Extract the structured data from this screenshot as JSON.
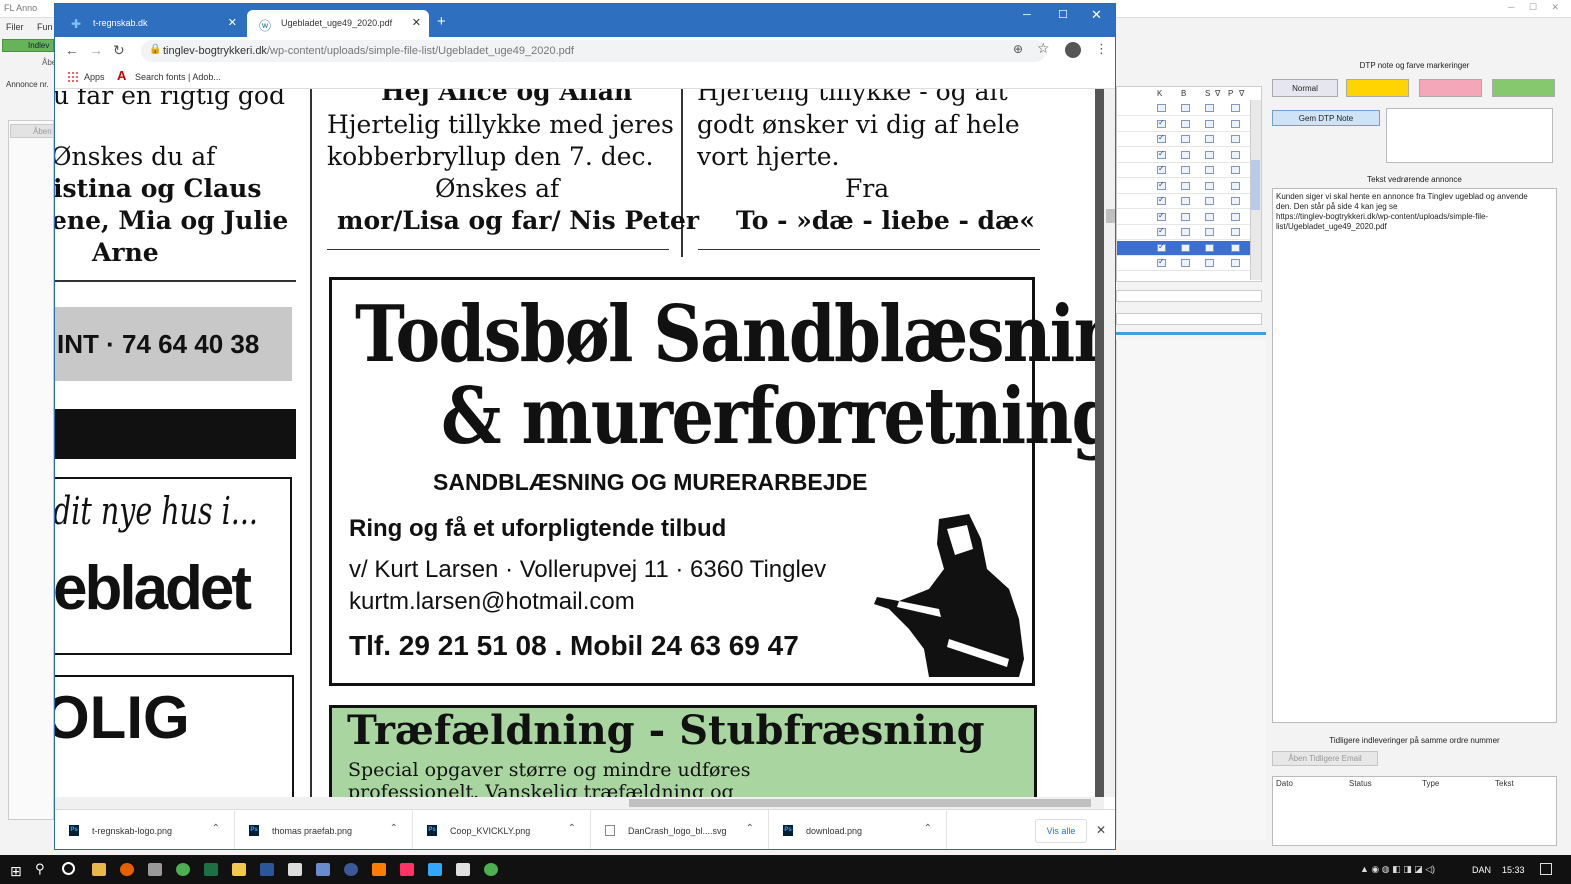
{
  "bg_app": {
    "title": "FL Anno",
    "menu": [
      "Filer",
      "Fun"
    ],
    "tab_indlevering": "Indlev",
    "aben_label": "Åbe",
    "annonce_label": "Annonce nr.",
    "left_aben_button": "Åben",
    "grid_headers": [
      "K",
      "B",
      "S",
      "∇",
      "P",
      "∇"
    ]
  },
  "right_panel": {
    "dtp_header": "DTP note og farve markeringer",
    "color_buttons": [
      {
        "label": "Normal",
        "color": "#e6e6f0"
      },
      {
        "label": "",
        "color": "#ffd400"
      },
      {
        "label": "",
        "color": "#f4a7b9"
      },
      {
        "label": "",
        "color": "#86c86e"
      }
    ],
    "gem_button": "Gem DTP Note",
    "tekst_header": "Tekst vedrørende annonce",
    "tekst_lines": [
      "Kunden siger vi skal hente en annonce fra Tinglev ugeblad og anvende",
      "den. Den står på side 4 kan jeg se",
      "https://tinglev-bogtrykkeri.dk/wp-content/uploads/simple-file-",
      "list/Ugebladet_uge49_2020.pdf"
    ],
    "tidligere_header": "Tidligere indleveringer på samme ordre nummer",
    "aben_email_button": "Åben Tidligere Email",
    "table_headers": [
      "Dato",
      "Status",
      "Type",
      "Tekst"
    ]
  },
  "browser": {
    "tabs": [
      {
        "label": "t-regnskab.dk",
        "active": false
      },
      {
        "label": "Ugebladet_uge49_2020.pdf",
        "active": true
      }
    ],
    "url_domain": "tinglev-bogtrykkeri.dk",
    "url_path": "/wp-content/uploads/simple-file-list/Ugebladet_uge49_2020.pdf",
    "bookmarks": [
      "Apps",
      "Search fonts | Adob..."
    ]
  },
  "pdf": {
    "col1": {
      "line1": "u far en rigtig god",
      "line2": "Ønskes du af",
      "line3": "istina og Claus",
      "line4": "ene, Mia og Julie",
      "line5": "Arne",
      "phone": "INT · 74 64 40 38",
      "ad_script": "dit nye hus i...",
      "ad_brand": "ebladet",
      "ad_big": "OLIG"
    },
    "col2": {
      "line0": "Hej Alice og Allan",
      "line1": "Hjertelig tillykke med jeres",
      "line2": "kobberbryllup den 7. dec.",
      "line3": "Ønskes af",
      "line4": "mor/Lisa og far/ Nis Peter"
    },
    "col3": {
      "line0": "Hjertelig tillykke - og alt",
      "line1": "godt ønsker vi dig af hele",
      "line2": "vort hjerte.",
      "line3": "Fra",
      "line4": "To - »dæ - liebe - dæ«"
    },
    "ad1": {
      "title1": "Todsbøl Sandblæsning",
      "title2": "& murerforretning",
      "subtitle": "SANDBLÆSNING OG MURERARBEJDE",
      "call": "Ring og få et uforpligtende tilbud",
      "address": "v/ Kurt Larsen · Vollerupvej 11 · 6360 Tinglev",
      "email": "kurtm.larsen@hotmail.com",
      "phones": "Tlf. 29 21 51 08 . Mobil 24 63 69 47"
    },
    "ad2": {
      "title": "Træfældning - Stubfræsning",
      "line1": "Special opgaver større og mindre udføres",
      "line2": "professionelt. Vanskelig træfældning og"
    }
  },
  "downloads": {
    "items": [
      {
        "name": "t-regnskab-logo.png",
        "type": "ps"
      },
      {
        "name": "thomas praefab.png",
        "type": "ps"
      },
      {
        "name": "Coop_KVICKLY.png",
        "type": "ps"
      },
      {
        "name": "DanCrash_logo_bl....svg",
        "type": "svg"
      },
      {
        "name": "download.png",
        "type": "ps"
      }
    ],
    "show_all": "Vis alle"
  },
  "taskbar": {
    "tray_text": "DAN",
    "time": "15:33"
  }
}
